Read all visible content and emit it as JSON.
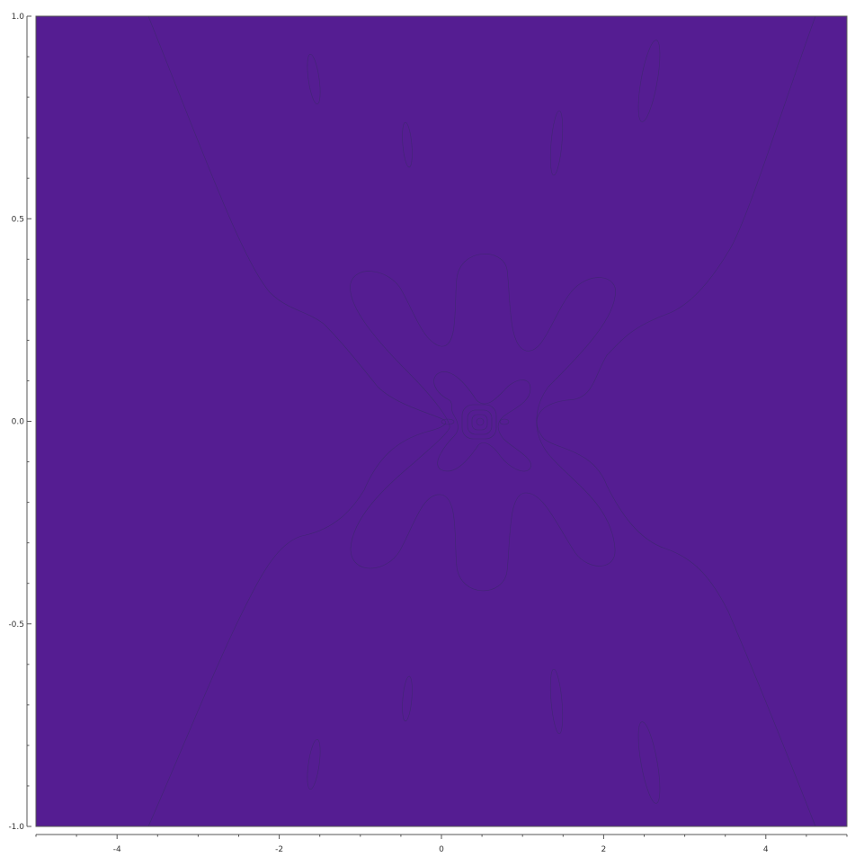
{
  "chart_data": {
    "type": "contour",
    "title": "",
    "xlabel": "",
    "ylabel": "",
    "xlim": [
      -5,
      5
    ],
    "ylim": [
      -1,
      1
    ],
    "x_ticks": [
      {
        "value": -4,
        "label": "-4"
      },
      {
        "value": -2,
        "label": "-2"
      },
      {
        "value": 0,
        "label": "0"
      },
      {
        "value": 2,
        "label": "2"
      },
      {
        "value": 4,
        "label": "4"
      }
    ],
    "y_ticks": [
      {
        "value": 1.0,
        "label": "1.0"
      },
      {
        "value": 0.5,
        "label": "0.5"
      },
      {
        "value": 0.0,
        "label": "0.0"
      },
      {
        "value": -0.5,
        "label": "-0.5"
      },
      {
        "value": -1.0,
        "label": "-1.0"
      }
    ],
    "levels": [
      {
        "name": "level-1",
        "color": "#551d92"
      },
      {
        "name": "level-2",
        "color": "#6440ab"
      },
      {
        "name": "level-3",
        "color": "#7860c6"
      },
      {
        "name": "level-4",
        "color": "#8e80e0"
      },
      {
        "name": "level-5",
        "color": "#a9a4ea"
      },
      {
        "name": "level-6",
        "color": "#c8d6ea"
      },
      {
        "name": "level-7",
        "color": "#e3edd4"
      },
      {
        "name": "level-8",
        "color": "#fdfae0"
      }
    ],
    "peak": {
      "x": 0.48,
      "y": 0.0
    }
  }
}
